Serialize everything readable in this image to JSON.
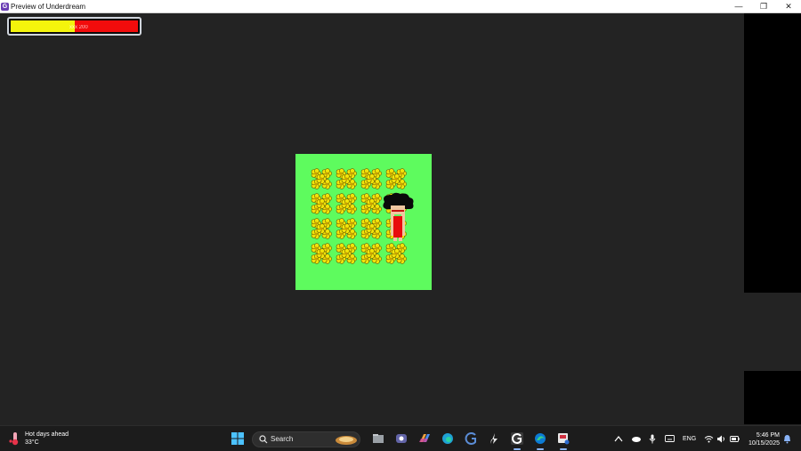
{
  "window": {
    "title": "Preview of Underdream",
    "icon": "gamemaker-icon",
    "controls": {
      "minimize": "—",
      "maximize": "❐",
      "close": "✕"
    }
  },
  "game": {
    "hp_bar": {
      "text": "xxx 200",
      "fill_ratio": 0.5,
      "fill_color": "#f4f40c",
      "bg_color": "#f20c0c"
    },
    "field_color": "#5efb5e",
    "flower_rows": 4,
    "flower_cols": 4,
    "player_shirt_color": "#e80c0c"
  },
  "taskbar": {
    "weather": {
      "line1": "Hot days ahead",
      "line2": "33°C",
      "icon": "thermometer-icon"
    },
    "search_label": "Search",
    "pinned_apps": [
      "start-icon",
      "search-icon",
      "file-explorer-icon",
      "teams-icon",
      "copilot-icon",
      "edge-icon",
      "gamemaker-icon",
      "sketch-icon",
      "gamemaker-icon",
      "edge-icon",
      "snipping-tool-icon"
    ],
    "tray": {
      "language": "ENG"
    },
    "clock": {
      "time": "5:46 PM",
      "date": "10/15/2025"
    }
  }
}
